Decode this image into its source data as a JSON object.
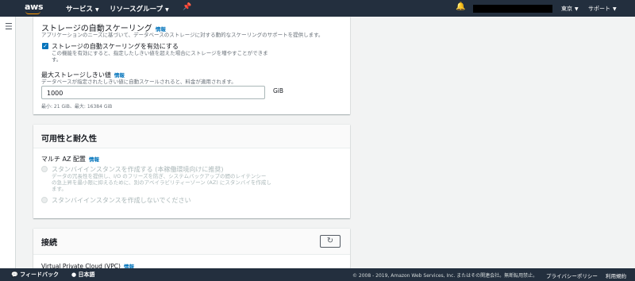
{
  "topnav": {
    "logo": "aws",
    "services": "サービス",
    "resource_groups": "リソースグループ",
    "region": "東京",
    "support": "サポート"
  },
  "storage_autoscaling": {
    "title": "ストレージの自動スケーリング",
    "info": "情報",
    "description": "アプリケーションのニーズに基づいて、データベースのストレージに対する動的なスケーリングのサポートを提供します。",
    "enable_label": "ストレージの自動スケーリングを有効にする",
    "enable_desc_1": "この機能を有効にすると、指定したしきい値を超えた場合にストレージを増やすことができま",
    "enable_desc_2": "す。",
    "enabled": true,
    "max_threshold_label": "最大ストレージしきい値",
    "max_threshold_info": "情報",
    "max_threshold_desc": "データベースが指定されたしきい値に自動スケールされると、料金が適用されます。",
    "max_threshold_value": "1000",
    "unit": "GiB",
    "hint": "最小: 21 GiB、最大: 16384 GiB"
  },
  "availability": {
    "title": "可用性と耐久性",
    "multi_az_label": "マルチ AZ 配置",
    "multi_az_info": "情報",
    "option1_label": "スタンバイインスタンスを作成する (本稼働環境向けに推奨)",
    "option1_desc_1": "データの冗長性を提供し、I/O のフリーズを防ぎ、システムバックアップの間のレイテンシー",
    "option1_desc_2": "の急上昇を最小限に抑えるために、別のアベイラビリティーゾーン (AZ) にスタンバイを作成し",
    "option1_desc_3": "ます。",
    "option2_label": "スタンバイインスタンスを作成しないでください"
  },
  "connectivity": {
    "title": "接続",
    "vpc_label": "Virtual Private Cloud (VPC)",
    "vpc_info": "情報"
  },
  "footer": {
    "feedback": "フィードバック",
    "language": "日本語",
    "copyright": "© 2008 - 2019, Amazon Web Services, Inc. またはその関連会社。無断転用禁止。",
    "privacy": "プライバシーポリシー",
    "terms": "利用規約"
  }
}
